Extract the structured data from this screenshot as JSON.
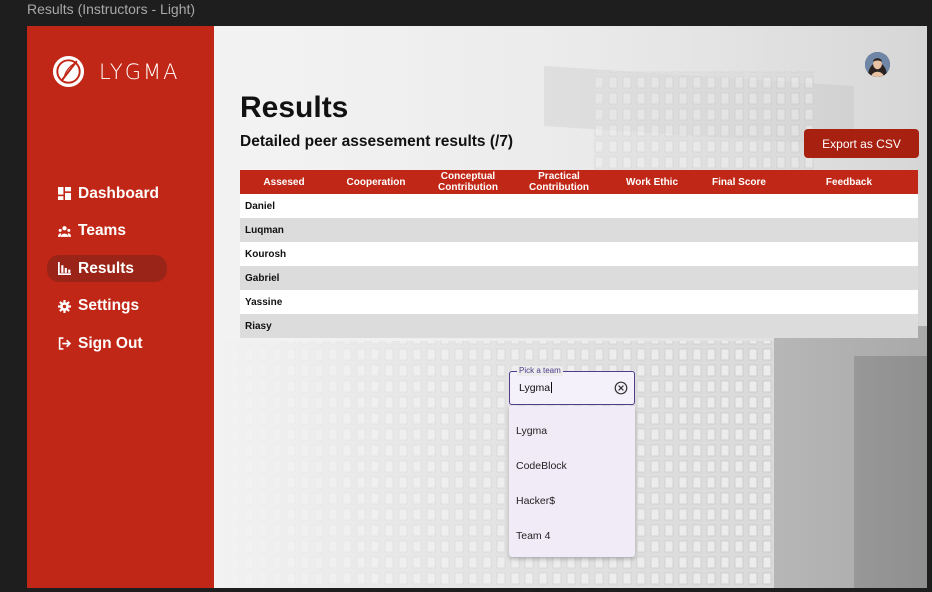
{
  "frame": {
    "label": "Results (Instructors - Light)"
  },
  "brand": {
    "name": "LYGMA"
  },
  "colors": {
    "primary": "#c12716",
    "active_nav": "#9a2418",
    "export_button": "#a8200f",
    "field_border": "#4e3d8a",
    "dropdown_bg": "#f1ebf8"
  },
  "nav": [
    {
      "label": "Dashboard",
      "icon": "dashboard-icon",
      "active": false
    },
    {
      "label": "Teams",
      "icon": "teams-icon",
      "active": false
    },
    {
      "label": "Results",
      "icon": "bar-chart-icon",
      "active": true
    },
    {
      "label": "Settings",
      "icon": "gear-icon",
      "active": false
    },
    {
      "label": "Sign Out",
      "icon": "sign-out-icon",
      "active": false
    }
  ],
  "page": {
    "title": "Results",
    "subtitle": "Detailed peer assesement results (/7)",
    "export_label": "Export as CSV"
  },
  "table": {
    "headers": [
      "Assesed",
      "Cooperation",
      "Conceptual Contribution",
      "Practical Contribution",
      "Work Ethic",
      "Final Score",
      "Feedback"
    ],
    "rows": [
      "Daniel",
      "Luqman",
      "Kourosh",
      "Gabriel",
      "Yassine",
      "Riasy"
    ]
  },
  "team_picker": {
    "label": "Pick a team",
    "value": "Lygma",
    "options": [
      "Lygma",
      "CodeBlock",
      "Hacker$",
      "Team 4"
    ]
  }
}
